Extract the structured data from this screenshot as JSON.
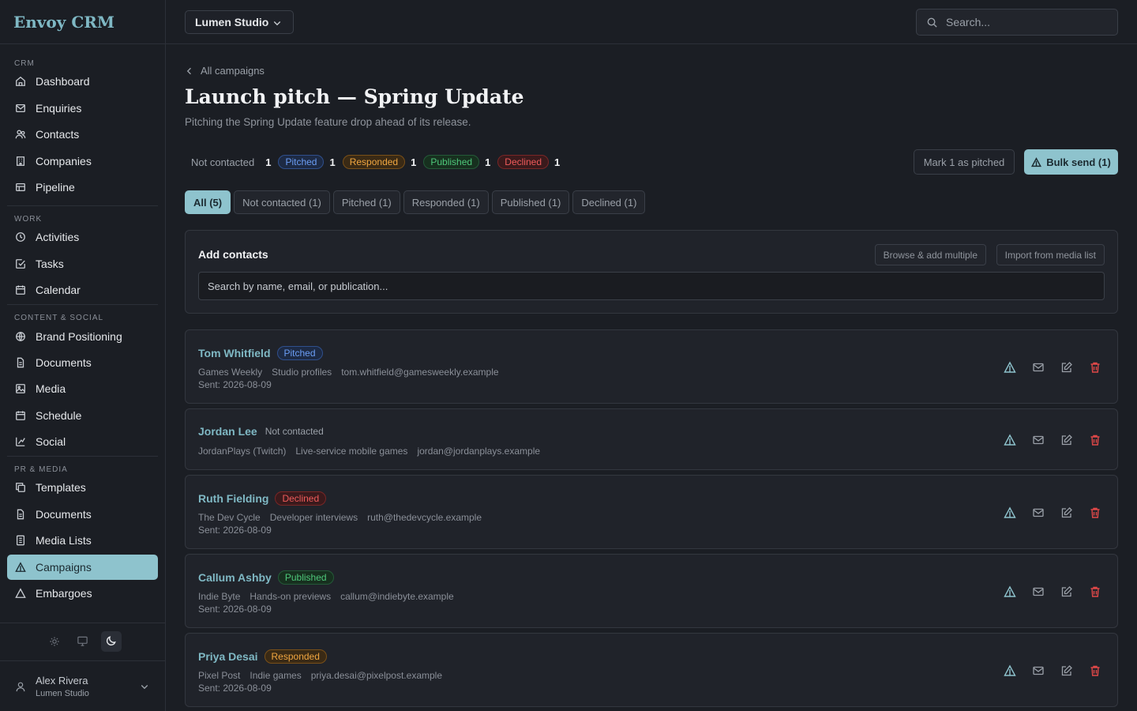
{
  "app": {
    "name": "Envoy CRM"
  },
  "workspace": {
    "name": "Lumen Studio"
  },
  "search": {
    "placeholder": "Search..."
  },
  "sidebar": {
    "sections": [
      {
        "label": "CRM",
        "items": [
          {
            "label": "Dashboard",
            "icon": "home-icon"
          },
          {
            "label": "Enquiries",
            "icon": "inbox-icon"
          },
          {
            "label": "Contacts",
            "icon": "users-icon"
          },
          {
            "label": "Companies",
            "icon": "building-icon"
          },
          {
            "label": "Pipeline",
            "icon": "kanban-icon"
          }
        ]
      },
      {
        "label": "WORK",
        "items": [
          {
            "label": "Activities",
            "icon": "clock-icon"
          },
          {
            "label": "Tasks",
            "icon": "check-square-icon"
          },
          {
            "label": "Calendar",
            "icon": "calendar-icon"
          }
        ]
      },
      {
        "label": "CONTENT & SOCIAL",
        "items": [
          {
            "label": "Brand Positioning",
            "icon": "globe-icon"
          },
          {
            "label": "Documents",
            "icon": "file-icon"
          },
          {
            "label": "Media",
            "icon": "image-icon"
          },
          {
            "label": "Schedule",
            "icon": "calendar-icon"
          },
          {
            "label": "Social",
            "icon": "share-icon"
          }
        ]
      },
      {
        "label": "PR & MEDIA",
        "items": [
          {
            "label": "Templates",
            "icon": "copy-icon"
          },
          {
            "label": "Documents",
            "icon": "file-icon"
          },
          {
            "label": "Media Lists",
            "icon": "list-icon"
          },
          {
            "label": "Campaigns",
            "icon": "triangle-icon",
            "active": true
          },
          {
            "label": "Embargoes",
            "icon": "warning-icon"
          }
        ]
      }
    ]
  },
  "user": {
    "name": "Alex Rivera",
    "org": "Lumen Studio"
  },
  "page": {
    "breadcrumb": "All campaigns",
    "title": "Launch pitch — Spring Update",
    "subtitle": "Pitching the Spring Update feature drop ahead of its release."
  },
  "stats": [
    {
      "label": "Not contacted",
      "count": "1",
      "style": "plain"
    },
    {
      "label": "Pitched",
      "count": "1",
      "style": "pitched"
    },
    {
      "label": "Responded",
      "count": "1",
      "style": "responded"
    },
    {
      "label": "Published",
      "count": "1",
      "style": "published"
    },
    {
      "label": "Declined",
      "count": "1",
      "style": "declined"
    }
  ],
  "actions": {
    "mark_pitched": "Mark 1 as pitched",
    "bulk_send": "Bulk send (1)"
  },
  "tabs": [
    {
      "label": "All (5)",
      "active": true
    },
    {
      "label": "Not contacted (1)"
    },
    {
      "label": "Pitched (1)"
    },
    {
      "label": "Responded (1)"
    },
    {
      "label": "Published (1)"
    },
    {
      "label": "Declined (1)"
    }
  ],
  "add_contacts": {
    "title": "Add contacts",
    "browse": "Browse & add multiple",
    "import": "Import from media list",
    "placeholder": "Search by name, email, or publication..."
  },
  "contacts": [
    {
      "name": "Tom Whitfield",
      "status": "Pitched",
      "status_style": "pitched",
      "outlet": "Games Weekly",
      "beat": "Studio profiles",
      "email": "tom.whitfield@gamesweekly.example",
      "sent": "Sent: 2026-08-09"
    },
    {
      "name": "Jordan Lee",
      "status": "Not contacted",
      "status_style": "plain",
      "outlet": "JordanPlays (Twitch)",
      "beat": "Live-service mobile games",
      "email": "jordan@jordanplays.example",
      "sent": ""
    },
    {
      "name": "Ruth Fielding",
      "status": "Declined",
      "status_style": "declined",
      "outlet": "The Dev Cycle",
      "beat": "Developer interviews",
      "email": "ruth@thedevcycle.example",
      "sent": "Sent: 2026-08-09"
    },
    {
      "name": "Callum Ashby",
      "status": "Published",
      "status_style": "published",
      "outlet": "Indie Byte",
      "beat": "Hands-on previews",
      "email": "callum@indiebyte.example",
      "sent": "Sent: 2026-08-09"
    },
    {
      "name": "Priya Desai",
      "status": "Responded",
      "status_style": "responded",
      "outlet": "Pixel Post",
      "beat": "Indie games",
      "email": "priya.desai@pixelpost.example",
      "sent": "Sent: 2026-08-09"
    }
  ],
  "colors": {
    "accent": "#8ec3cd",
    "link": "#7fb8c4",
    "danger": "#e04848",
    "background": "#1b1e24"
  }
}
